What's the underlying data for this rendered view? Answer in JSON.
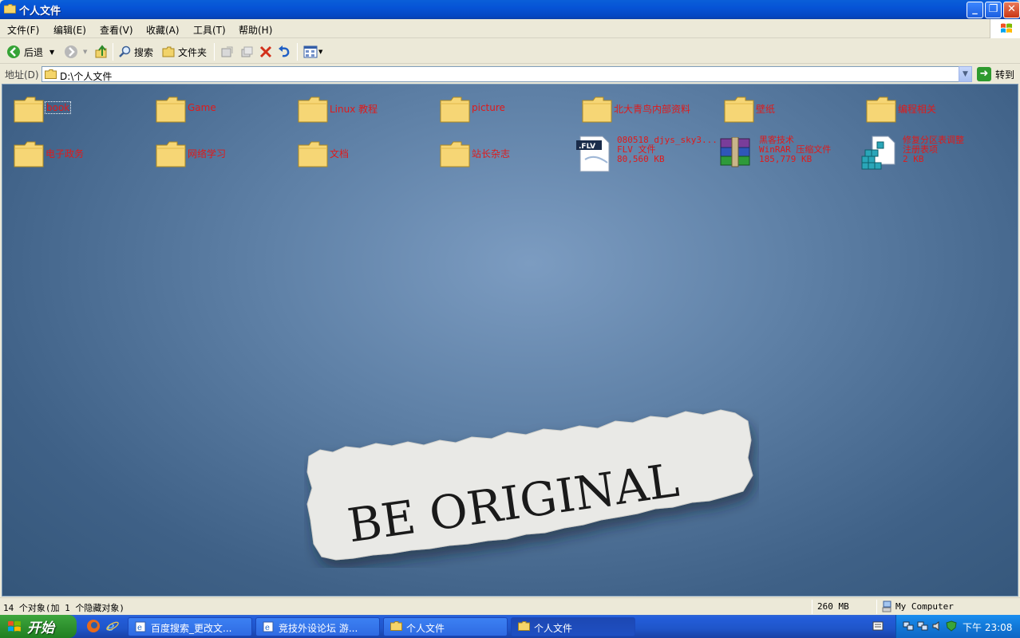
{
  "window": {
    "title": "个人文件",
    "icon": "folder-icon"
  },
  "menu": [
    "文件(F)",
    "编辑(E)",
    "查看(V)",
    "收藏(A)",
    "工具(T)",
    "帮助(H)"
  ],
  "toolbar": {
    "back_label": "后退",
    "search_label": "搜索",
    "folders_label": "文件夹"
  },
  "address": {
    "label": "地址(D)",
    "value": "D:\\个人文件",
    "go_label": "转到"
  },
  "items": [
    {
      "name": "book",
      "type": "folder"
    },
    {
      "name": "Game",
      "type": "folder"
    },
    {
      "name": "Linux 教程",
      "type": "folder"
    },
    {
      "name": "picture",
      "type": "folder"
    },
    {
      "name": "北大青鸟内部资料",
      "type": "folder"
    },
    {
      "name": "壁纸",
      "type": "folder"
    },
    {
      "name": "编程相关",
      "type": "folder"
    },
    {
      "name": "电子政务",
      "type": "folder"
    },
    {
      "name": "网络学习",
      "type": "folder"
    },
    {
      "name": "文档",
      "type": "folder"
    },
    {
      "name": "站长杂志",
      "type": "folder"
    },
    {
      "name": "080518_djys_sky3...",
      "type": "FLV 文件",
      "size": "80,560 KB"
    },
    {
      "name": "黑客技术",
      "type": "WinRAR 压缩文件",
      "size": "185,779 KB"
    },
    {
      "name": "修复分区表调整",
      "type": "注册表项",
      "size": "2 KB"
    }
  ],
  "wallpaper": {
    "text": "BE ORIGINAL"
  },
  "status": {
    "objects": "14 个对象(加 1 个隐藏对象)",
    "size": "260 MB",
    "zone": "My Computer"
  },
  "taskbar": {
    "start_label": "开始",
    "tasks": [
      "百度搜索_更改文...",
      "竞技外设论坛 游...",
      "个人文件",
      "个人文件"
    ],
    "clock": "下午 23:08"
  },
  "colors": {
    "titlebar": "#0653d6",
    "item_label": "#e01a1a",
    "start": "#2f922f"
  }
}
